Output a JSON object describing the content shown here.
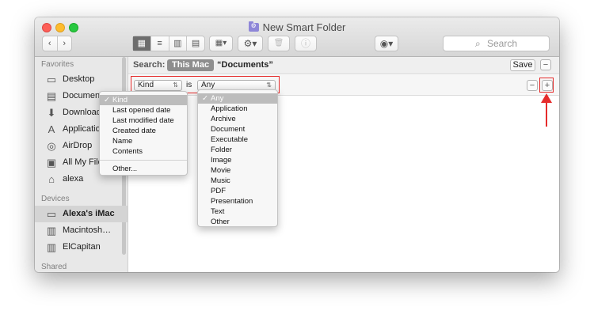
{
  "window": {
    "title": "New Smart Folder"
  },
  "toolbar": {
    "back": "‹",
    "forward": "›",
    "view_icons": [
      "▦",
      "≡",
      "▥",
      "▤"
    ],
    "group_icon": "▦▾",
    "action_icon": "⚙▾",
    "delete_icon": "🗑",
    "info_icon": "ⓘ",
    "share_icon": "◉▾"
  },
  "search": {
    "placeholder": "Search"
  },
  "sidebar": {
    "favorites_header": "Favorites",
    "favorites": [
      {
        "label": "Desktop",
        "icon": "desktop-icon",
        "glyph": "▭"
      },
      {
        "label": "Documents",
        "icon": "documents-icon",
        "glyph": "▤"
      },
      {
        "label": "Downloads",
        "icon": "downloads-icon",
        "glyph": "⬇"
      },
      {
        "label": "Applications",
        "icon": "applications-icon",
        "glyph": "A"
      },
      {
        "label": "AirDrop",
        "icon": "airdrop-icon",
        "glyph": "◎"
      },
      {
        "label": "All My Files",
        "icon": "all-files-icon",
        "glyph": "▣"
      },
      {
        "label": "alexa",
        "icon": "home-icon",
        "glyph": "⌂"
      }
    ],
    "devices_header": "Devices",
    "devices": [
      {
        "label": "Alexa's iMac",
        "icon": "imac-icon",
        "glyph": "▭"
      },
      {
        "label": "Macintosh…",
        "icon": "disk-icon",
        "glyph": "▥"
      },
      {
        "label": "ElCapitan",
        "icon": "disk-icon",
        "glyph": "▥"
      }
    ],
    "shared_header": "Shared"
  },
  "searchbar": {
    "label": "Search:",
    "scope_this_mac": "This Mac",
    "scope_documents": "“Documents”",
    "save": "Save",
    "minus": "−"
  },
  "rule": {
    "attribute": "Kind",
    "operator": "is",
    "value": "Any",
    "minus": "−",
    "plus": "+"
  },
  "attribute_menu": {
    "items": [
      "Kind",
      "Last opened date",
      "Last modified date",
      "Created date",
      "Name",
      "Contents"
    ],
    "other": "Other...",
    "check": "✓"
  },
  "kind_menu": {
    "items": [
      "Any",
      "Application",
      "Archive",
      "Document",
      "Executable",
      "Folder",
      "Image",
      "Movie",
      "Music",
      "PDF",
      "Presentation",
      "Text",
      "Other"
    ],
    "check": "✓"
  },
  "colors": {
    "annotation_red": "#e52b2b"
  }
}
